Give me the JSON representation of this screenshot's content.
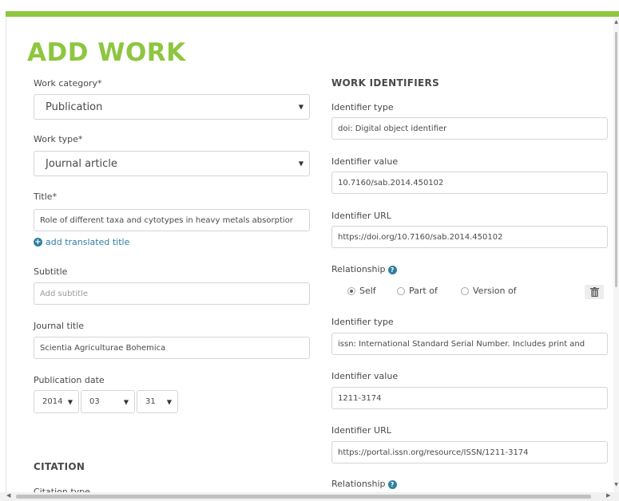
{
  "page": {
    "title": "ADD WORK"
  },
  "left": {
    "work_category_label": "Work category*",
    "work_category_value": "Publication",
    "work_type_label": "Work type*",
    "work_type_value": "Journal article",
    "title_label": "Title*",
    "title_value": "Role of different taxa and cytotypes in heavy metals absorptior",
    "add_translated_title": "add translated title",
    "subtitle_label": "Subtitle",
    "subtitle_placeholder": "Add subtitle",
    "journal_title_label": "Journal title",
    "journal_title_value": "Scientia Agriculturae Bohemica",
    "publication_date_label": "Publication date",
    "pub_year": "2014",
    "pub_month": "03",
    "pub_day": "31",
    "citation_section": "CITATION",
    "citation_type_label": "Citation type"
  },
  "right": {
    "section": "WORK IDENTIFIERS",
    "identifiers": [
      {
        "type_label": "Identifier type",
        "type_value": "doi: Digital object identifier",
        "value_label": "Identifier value",
        "value": "10.7160/sab.2014.450102",
        "url_label": "Identifier URL",
        "url": "https://doi.org/10.7160/sab.2014.450102",
        "relationship_label": "Relationship",
        "relationship_options": [
          "Self",
          "Part of",
          "Version of"
        ],
        "relationship_selected": "Self"
      },
      {
        "type_label": "Identifier type",
        "type_value": "issn: International Standard Serial Number. Includes print and",
        "value_label": "Identifier value",
        "value": "1211-3174",
        "url_label": "Identifier URL",
        "url": "https://portal.issn.org/resource/ISSN/1211-3174",
        "relationship_label": "Relationship"
      }
    ]
  },
  "icons": {
    "help": "?",
    "plus": "+",
    "trash": "🗑",
    "arrow": "▼"
  },
  "colors": {
    "accent": "#8dc63f",
    "link": "#2e7f9f"
  }
}
